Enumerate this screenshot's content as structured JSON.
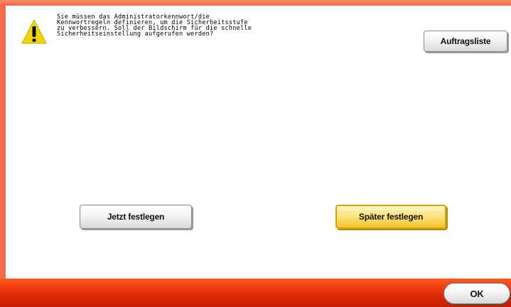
{
  "dialog": {
    "icon": "warning-icon",
    "message_lines": [
      "Sie müssen das Administratorkennwort/die",
      "Kennwortregeln definieren, um die Sicherheitsstufe",
      "zu verbessern. Soll der Bildschirm für die schnelle",
      "Sicherheitseinstellung aufgerufen werden?"
    ],
    "job_list_label": "Auftragsliste",
    "set_now_label": "Jetzt festlegen",
    "set_later_label": "Später festlegen",
    "ok_label": "OK"
  },
  "colors": {
    "frame": "#f26b4a",
    "bottom_bar": "#e02a08",
    "warning_yellow": "#f5d400",
    "selected_button": "#ffe27a"
  }
}
